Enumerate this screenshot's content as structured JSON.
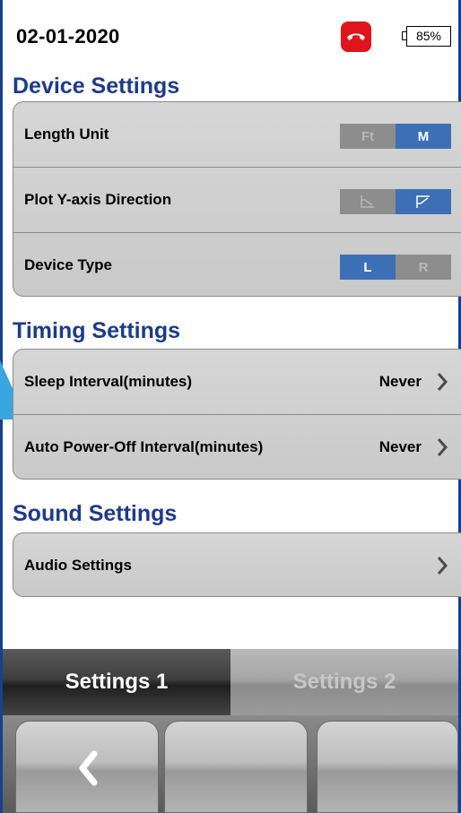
{
  "status_bar": {
    "date": "02-01-2020",
    "battery_percent": "85%",
    "hangup_icon": "phone-hangup-icon",
    "colors": {
      "hangup": "#e0141b"
    }
  },
  "sections": {
    "device": {
      "title": "Device Settings",
      "length_unit": {
        "label": "Length Unit",
        "options": [
          "Ft",
          "M"
        ],
        "selected": "M"
      },
      "plot_direction": {
        "label": "Plot Y-axis Direction",
        "options": [
          "plot-down-icon",
          "plot-up-icon"
        ],
        "selected": "plot-up-icon"
      },
      "device_type": {
        "label": "Device Type",
        "options": [
          "L",
          "R"
        ],
        "selected": "L"
      }
    },
    "timing": {
      "title": "Timing Settings",
      "sleep": {
        "label": "Sleep Interval(minutes)",
        "value": "Never"
      },
      "auto_off": {
        "label": "Auto Power-Off Interval(minutes)",
        "value": "Never"
      }
    },
    "sound": {
      "title": "Sound Settings",
      "audio": {
        "label": "Audio Settings"
      }
    }
  },
  "tabs": [
    {
      "label": "Settings 1",
      "active": true
    },
    {
      "label": "Settings 2",
      "active": false
    }
  ],
  "softkeys": {
    "left_icon": "back-chevron-icon"
  },
  "colors": {
    "section_title": "#1d3a8c",
    "toggle_on": "#3c6fb6",
    "toggle_off": "#8d8d8d"
  }
}
